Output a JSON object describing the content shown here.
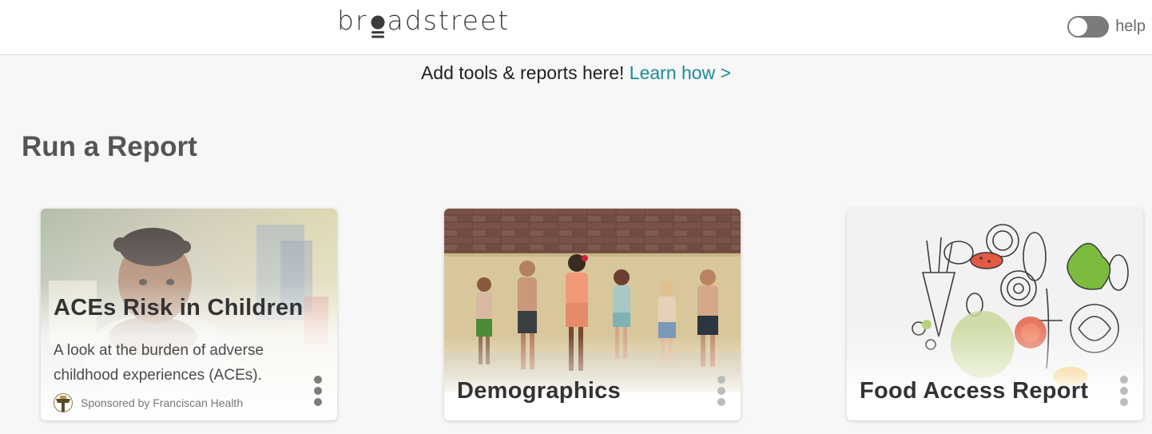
{
  "header": {
    "logo_text_left": "br",
    "logo_text_right": "adstreet",
    "help_toggle_on": false,
    "help_label": "help"
  },
  "banner": {
    "text": "Add tools & reports here! ",
    "link_label": "Learn how >"
  },
  "section": {
    "title": "Run a Report"
  },
  "cards": [
    {
      "title": "ACEs Risk in Children",
      "description": "A look at the burden of adverse childhood experiences (ACEs).",
      "sponsor": "Sponsored by Franciscan Health",
      "image_icon": "toddler-photo"
    },
    {
      "title": "Demographics",
      "image_icon": "children-fountain-photo"
    },
    {
      "title": "Food Access Report",
      "image_icon": "vegetables-illustration"
    }
  ],
  "colors": {
    "link": "#1a8a9c",
    "title": "#555555",
    "card_title": "#333333",
    "page_bg": "#f7f7f7"
  }
}
